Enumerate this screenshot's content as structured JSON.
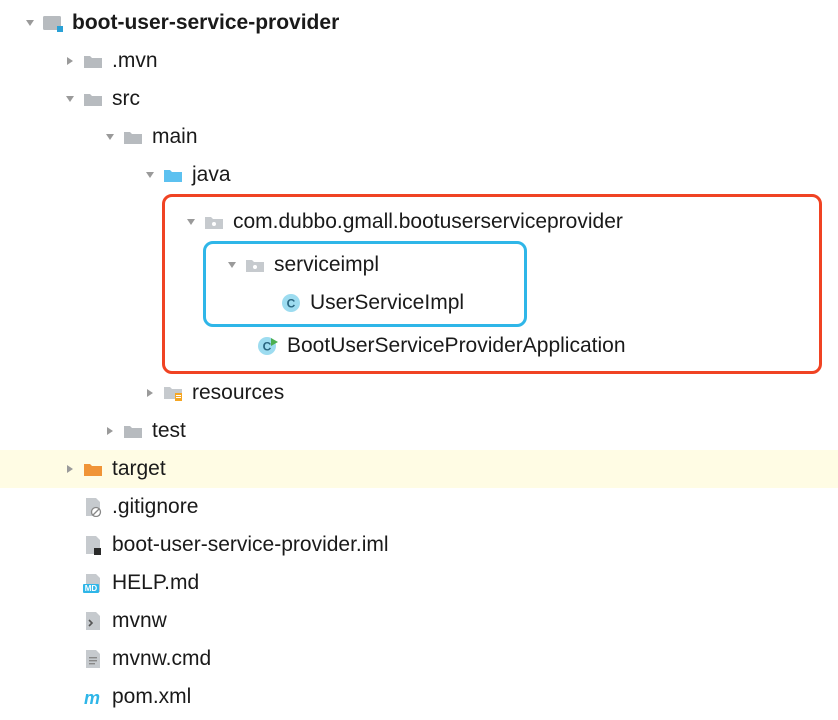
{
  "tree": {
    "root": "boot-user-service-provider",
    "mvn": ".mvn",
    "src": "src",
    "main": "main",
    "java": "java",
    "package": "com.dubbo.gmall.bootuserserviceprovider",
    "serviceimpl": "serviceimpl",
    "userServiceImpl": "UserServiceImpl",
    "bootApp": "BootUserServiceProviderApplication",
    "resources": "resources",
    "test": "test",
    "target": "target",
    "gitignore": ".gitignore",
    "iml": "boot-user-service-provider.iml",
    "help": "HELP.md",
    "mvnw": "mvnw",
    "mvnwcmd": "mvnw.cmd",
    "pom": "pom.xml"
  }
}
